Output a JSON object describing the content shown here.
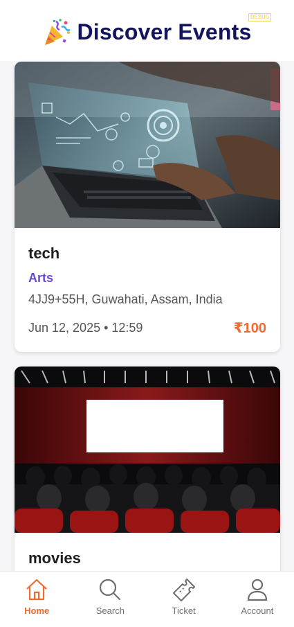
{
  "header": {
    "title": "Discover Events",
    "title_icon": "party-popper-icon",
    "debug_badge": "DEBUG"
  },
  "events": [
    {
      "title": "tech",
      "category": "Arts",
      "location": "4JJ9+55H, Guwahati, Assam, India",
      "datetime": "Jun 12, 2025 • 12:59",
      "price": "₹100",
      "image": "laptop-with-holographic-interface"
    },
    {
      "title": "movies",
      "image": "cinema-audience-screen"
    }
  ],
  "bottom_nav": {
    "items": [
      {
        "label": "Home",
        "icon": "home-icon",
        "active": true
      },
      {
        "label": "Search",
        "icon": "search-icon",
        "active": false
      },
      {
        "label": "Ticket",
        "icon": "ticket-icon",
        "active": false
      },
      {
        "label": "Account",
        "icon": "account-icon",
        "active": false
      }
    ]
  },
  "colors": {
    "title": "#12145e",
    "category": "#6a4ad6",
    "price": "#ef6a2e",
    "nav_active": "#ef6a2e",
    "nav_inactive": "#6e6e6e"
  }
}
